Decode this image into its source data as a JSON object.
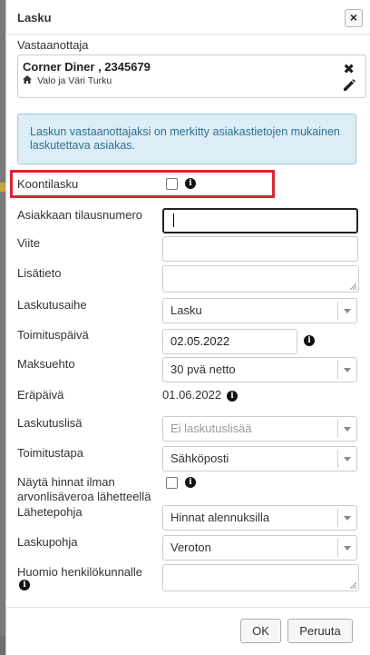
{
  "dialog": {
    "title": "Lasku",
    "close_label": "×"
  },
  "recipient": {
    "label": "Vastaanottaja",
    "name": "Corner Diner , 2345679",
    "sub": "Valo ja Väri Turku",
    "remove_label": "✖"
  },
  "info_message": "Laskun vastaanottajaksi on merkitty asiakastietojen mukainen laskutettava asiakas.",
  "fields": {
    "koontilasku": {
      "label": "Koontilasku",
      "checked": false
    },
    "tilausnumero": {
      "label": "Asiakkaan tilausnumero",
      "value": ""
    },
    "viite": {
      "label": "Viite",
      "value": ""
    },
    "lisatieto": {
      "label": "Lisätieto",
      "value": ""
    },
    "laskutusaihe": {
      "label": "Laskutusaihe",
      "value": "Lasku"
    },
    "toimituspaiva": {
      "label": "Toimituspäivä",
      "value": "02.05.2022"
    },
    "maksuehto": {
      "label": "Maksuehto",
      "value": "30 pvä netto"
    },
    "erapaiva": {
      "label": "Eräpäivä",
      "value": "01.06.2022"
    },
    "laskutuslisa": {
      "label": "Laskutuslisä",
      "placeholder": "Ei laskutuslisää"
    },
    "toimitustapa": {
      "label": "Toimitustapa",
      "value": "Sähköposti"
    },
    "nayta_hinnat": {
      "label_line1": "Näytä hinnat ilman",
      "label_line2": "arvonlisäveroa lähetteellä",
      "checked": false
    },
    "lahetepohja": {
      "label": "Lähetepohja",
      "value": "Hinnat alennuksilla"
    },
    "laskupohja": {
      "label": "Laskupohja",
      "value": "Veroton"
    },
    "huomio": {
      "label": "Huomio henkilökunnalle",
      "value": ""
    }
  },
  "buttons": {
    "ok": "OK",
    "cancel": "Peruuta"
  },
  "info_icon_glyph": "i",
  "colors": {
    "highlight": "#d6262f",
    "alert_bg": "#dcedf8",
    "alert_text": "#31708f"
  }
}
